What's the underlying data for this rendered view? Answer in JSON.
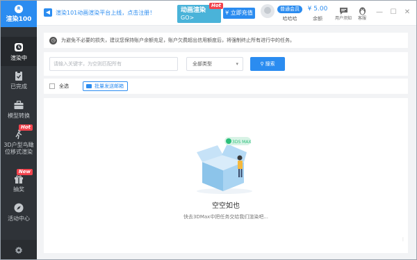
{
  "app": {
    "logo_mark": "R",
    "logo_text": "渲染100"
  },
  "sidebar": {
    "items": [
      {
        "label": "渲染中",
        "icon": "render-clock-icon"
      },
      {
        "label": "已完成",
        "icon": "clipboard-check-icon"
      },
      {
        "label": "模型转换",
        "icon": "briefcase-icon"
      },
      {
        "label": "3D户型鸟瞰\n位移式渲染",
        "icon": "person-walking-icon",
        "badge": "Hot"
      },
      {
        "label": "抽奖",
        "icon": "gift-icon",
        "badge": "New"
      },
      {
        "label": "活动中心",
        "icon": "compass-icon"
      }
    ],
    "settings_icon": "gear-icon"
  },
  "topbar": {
    "notice": "渲染101动画渲染平台上线，点击注册！",
    "promo_title": "动画渲染",
    "promo_sub": "GO>",
    "promo_badge": "Hot",
    "recharge": "¥ 立即充值",
    "member": "普通会员",
    "username": "哈哈哈",
    "balance": "¥ 5.00",
    "balance_label": "余额",
    "feedback_label": "用户须知",
    "service_label": "客服",
    "win_min": "—",
    "win_max": "☐",
    "win_close": "✕"
  },
  "main": {
    "alert": "为避免不必要的损失，建议您保持账户余额充足，账户欠费超出信用额度后，将强制终止所有进行中的任务。",
    "search_placeholder": "请输入关键字，为空则匹配所有",
    "type_select": "全部类型",
    "search_button": "搜索",
    "select_all": "全选",
    "send_mail": "批量发送邮箱",
    "empty_tag": "3DS MAX",
    "empty_title": "空空如也",
    "empty_sub": "快去3DMax中把任务交给我们渲染吧..."
  },
  "colors": {
    "accent": "#2b8cf0",
    "sidebar": "#2f3338",
    "badge": "#f2434d",
    "promo": "#4ab3d9"
  }
}
